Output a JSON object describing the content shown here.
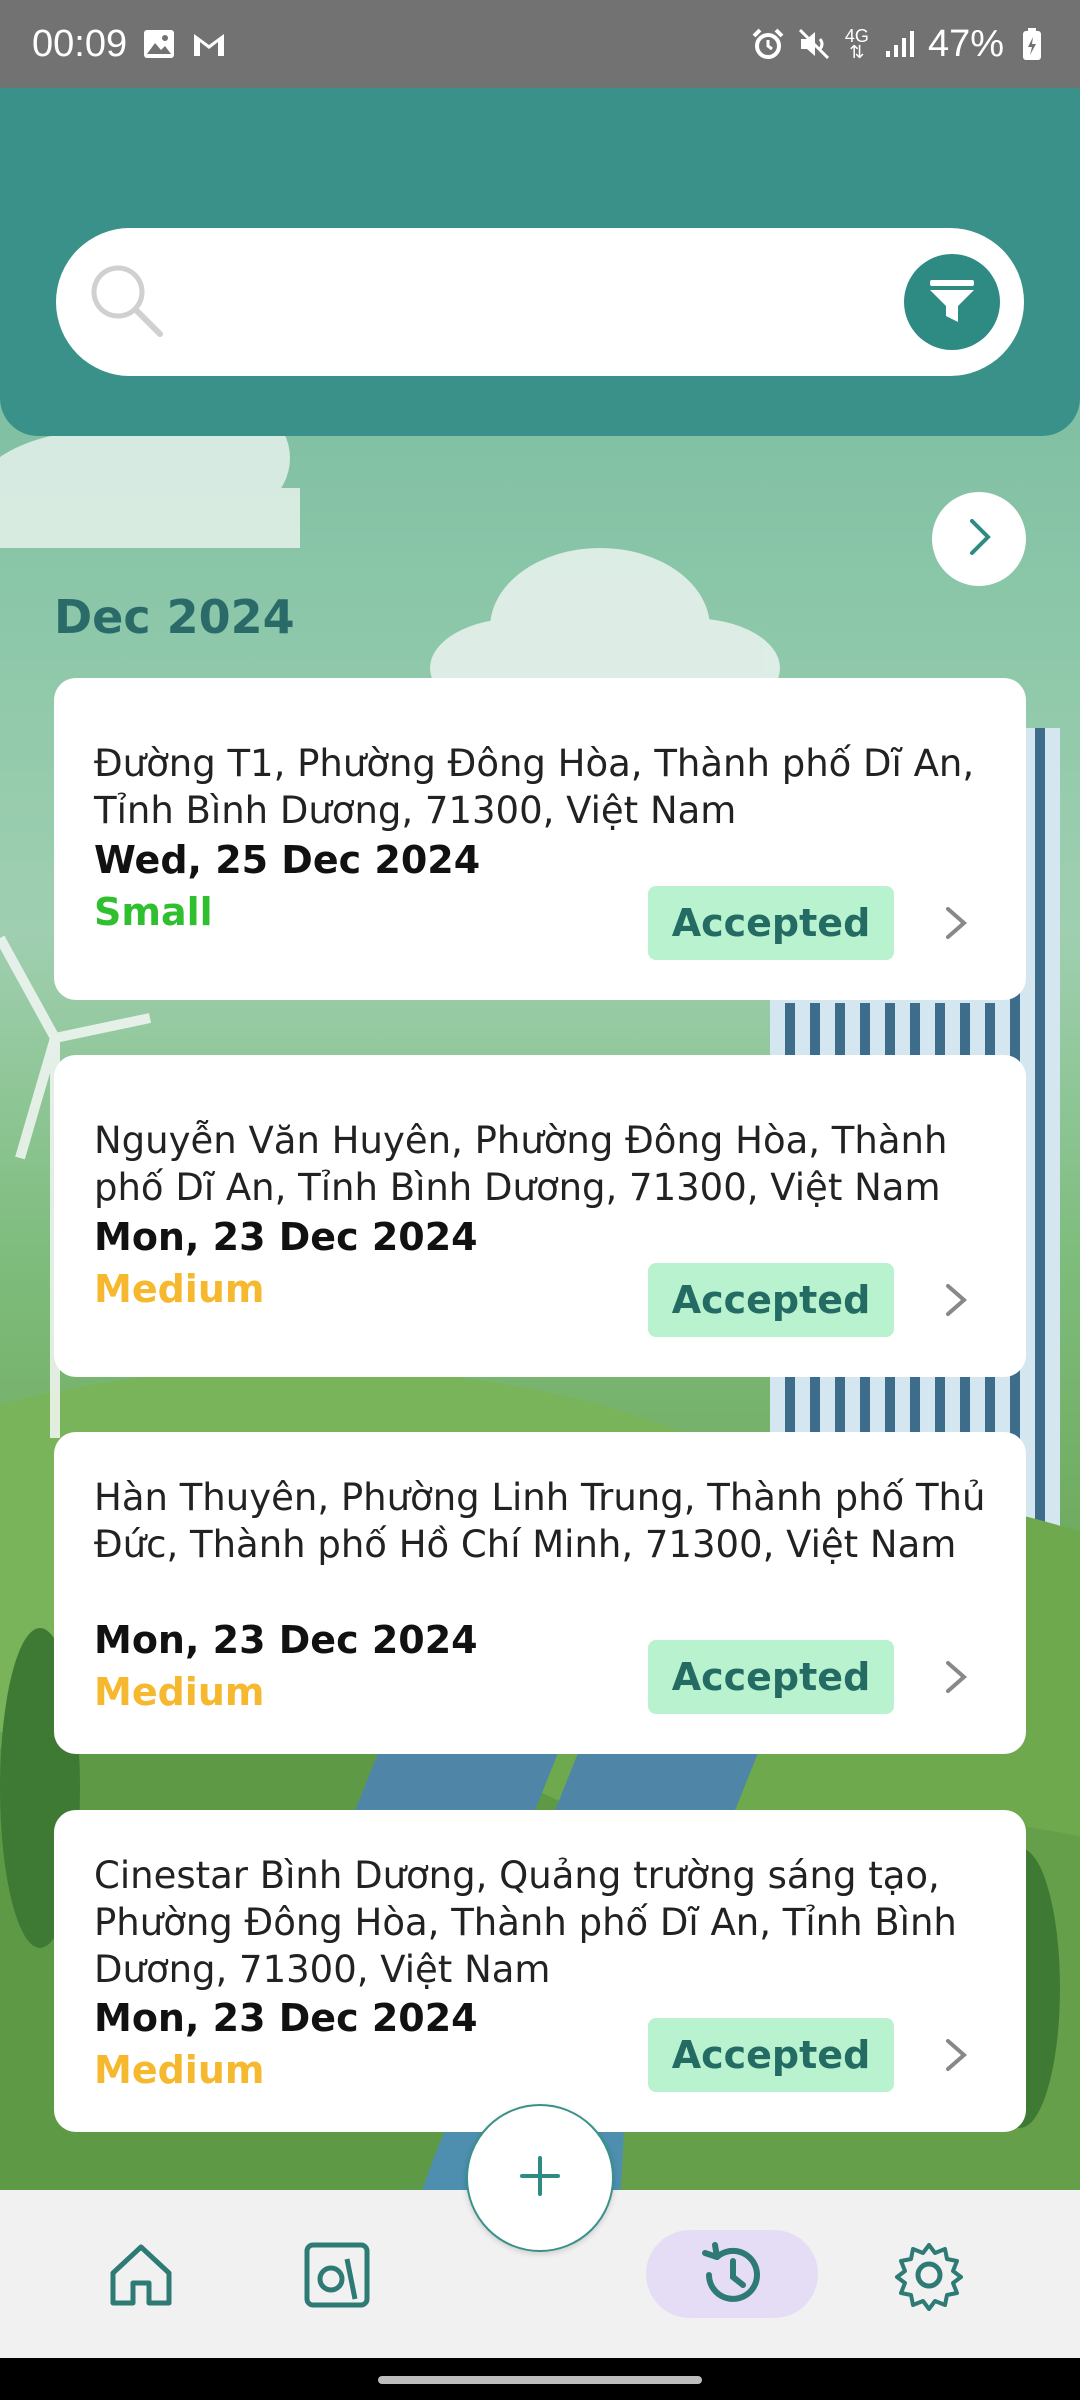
{
  "status_bar": {
    "time": "00:09",
    "battery": "47%",
    "network": "4G"
  },
  "search": {
    "placeholder": ""
  },
  "month_label": "Dec 2024",
  "bookings": [
    {
      "address": "Đường T1, Phường Đông Hòa, Thành phố Dĩ An, Tỉnh Bình Dương, 71300, Việt Nam",
      "date": "Wed, 25 Dec 2024",
      "size": "Small",
      "status": "Accepted"
    },
    {
      "address": "Nguyễn Văn Huyên, Phường Đông Hòa, Thành phố Dĩ An, Tỉnh Bình Dương, 71300, Việt Nam",
      "date": "Mon, 23 Dec 2024",
      "size": "Medium",
      "status": "Accepted"
    },
    {
      "address": "Hàn Thuyên, Phường Linh Trung, Thành phố Thủ Đức, Thành phố Hồ Chí Minh, 71300, Việt Nam",
      "date": "Mon, 23 Dec 2024",
      "size": "Medium",
      "status": "Accepted"
    },
    {
      "address": "Cinestar Bình Dương, Quảng trường sáng tạo, Phường Đông Hòa, Thành phố Dĩ An, Tỉnh Bình Dương, 71300, Việt Nam",
      "date": "Mon, 23 Dec 2024",
      "size": "Medium",
      "status": "Accepted"
    }
  ],
  "colors": {
    "header": "#3a9189",
    "accent": "#2e8b83",
    "size_small": "#2fbf2f",
    "size_medium": "#f5b82e",
    "status_bg": "#b8f2cf",
    "status_text": "#246b64",
    "nav_active_bg": "#e5dcf5"
  },
  "nav": {
    "items": [
      {
        "icon": "home-icon",
        "active": false
      },
      {
        "icon": "gallery-icon",
        "active": false
      },
      {
        "icon": "history-icon",
        "active": true
      },
      {
        "icon": "settings-icon",
        "active": false
      }
    ],
    "fab_icon": "plus-icon"
  }
}
